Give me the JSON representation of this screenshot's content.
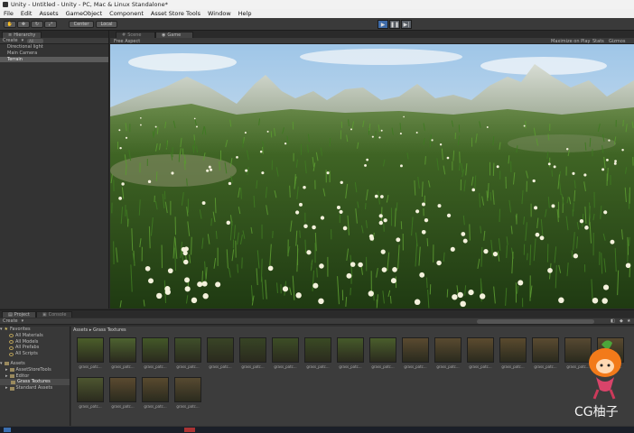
{
  "window": {
    "title": "Unity - Untitled - Unity - PC, Mac & Linux Standalone*"
  },
  "menu": [
    "File",
    "Edit",
    "Assets",
    "GameObject",
    "Component",
    "Asset Store Tools",
    "Window",
    "Help"
  ],
  "toolbar": {
    "coord_label": "Center",
    "space_label": "Local",
    "play_icon": "play-icon",
    "pause_icon": "pause-icon",
    "step_icon": "step-icon"
  },
  "hierarchy": {
    "tab": "Hierarchy",
    "create": "Create",
    "search_placeholder": "All",
    "items": [
      "Directional light",
      "Main Camera",
      "Terrain"
    ],
    "selected": "Terrain"
  },
  "viewport": {
    "tabs": [
      "Scene",
      "Game"
    ],
    "active_tab": "Game",
    "aspect": "Free Aspect",
    "maximize": "Maximize on Play",
    "stats": "Stats",
    "gizmos": "Gizmos"
  },
  "project": {
    "tabs": [
      "Project",
      "Console"
    ],
    "create": "Create",
    "tree": {
      "favorites_label": "Favorites",
      "favorites": [
        "All Materials",
        "All Models",
        "All Prefabs",
        "All Scripts"
      ],
      "assets_label": "Assets",
      "folders": [
        "AssetStoreTools",
        "Editor",
        "Grass Textures",
        "Standard Assets"
      ],
      "selected_folder": "Grass Textures"
    },
    "breadcrumb": "Assets ▸ Grass Textures",
    "item_count": "4",
    "assets": [
      {
        "label": "grass_patc...",
        "tone": "#4b5e2a"
      },
      {
        "label": "grass_patc...",
        "tone": "#4d6230"
      },
      {
        "label": "grass_patc...",
        "tone": "#435828"
      },
      {
        "label": "grass_patc...",
        "tone": "#3f4f2a"
      },
      {
        "label": "grass_patc...",
        "tone": "#394526"
      },
      {
        "label": "grass_patc...",
        "tone": "#374425"
      },
      {
        "label": "grass_patc...",
        "tone": "#3d4e26"
      },
      {
        "label": "grass_patc...",
        "tone": "#3a4a24"
      },
      {
        "label": "grass_patc...",
        "tone": "#465a2a"
      },
      {
        "label": "grass_patc...",
        "tone": "#4a5e2c"
      },
      {
        "label": "grass_patc...",
        "tone": "#5a4a30"
      },
      {
        "label": "grass_patc...",
        "tone": "#594a30"
      },
      {
        "label": "grass_patc...",
        "tone": "#5c4b2f"
      },
      {
        "label": "grass_patc...",
        "tone": "#5a4a2e"
      },
      {
        "label": "grass_patc...",
        "tone": "#5b4b31"
      },
      {
        "label": "grass_patc...",
        "tone": "#574932"
      },
      {
        "label": "grass_patc...",
        "tone": "#5a4a30"
      },
      {
        "label": "grass_patc...",
        "tone": "#4d5630"
      },
      {
        "label": "grass_patc...",
        "tone": "#5b4a30"
      },
      {
        "label": "grass_patc...",
        "tone": "#594a2f"
      },
      {
        "label": "grass_patc...",
        "tone": "#574a31"
      }
    ]
  },
  "watermark": {
    "text": "CG柚子"
  },
  "colors": {
    "selection": "#5c5c5c",
    "play_active": "#3f6ba8",
    "panel": "#333333"
  }
}
